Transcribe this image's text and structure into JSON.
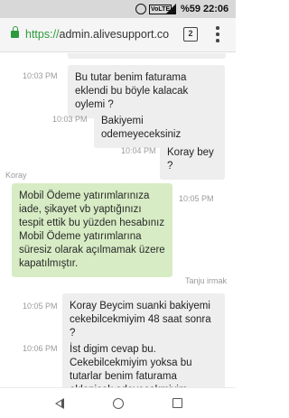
{
  "status_bar": {
    "network_label": "VoLTE",
    "battery": "%59",
    "time": "22:06"
  },
  "browser": {
    "url_scheme": "https://",
    "url_host": "admin.alivesupport.co",
    "tab_count": "2"
  },
  "messages": [
    {
      "from": "agent",
      "time": "10:03 PM",
      "text": "Bu tutar benim faturama eklendi bu böyle kalacak oylemi ?"
    },
    {
      "from": "agent",
      "time": "10:03 PM",
      "text": "Bakiyemi odemeyeceksiniz"
    },
    {
      "from": "agent",
      "time": "10:04 PM",
      "text": "Koray bey ?"
    },
    {
      "from": "user",
      "sender": "Koray",
      "time": "10:05 PM",
      "text": "Mobil Ödeme yatırımlarınıza iade, şikayet vb yaptığınızı tespit ettik bu yüzden hesabınız Mobil Ödeme yatırımlarına süresiz olarak açılmamak üzere kapatılmıştır."
    },
    {
      "from": "agent",
      "sender": "Tanju irmak",
      "time": "10:05 PM",
      "text": "Koray Beycim suanki bakiyemi cekebilcekmiyim 48 saat sonra ?"
    },
    {
      "from": "agent",
      "time": "10:06 PM",
      "text": "İst digim cevap bu. Cekebilcekmiyim yoksa bu tutarlar benim faturama eklenicek odeyecekmiyim"
    }
  ]
}
